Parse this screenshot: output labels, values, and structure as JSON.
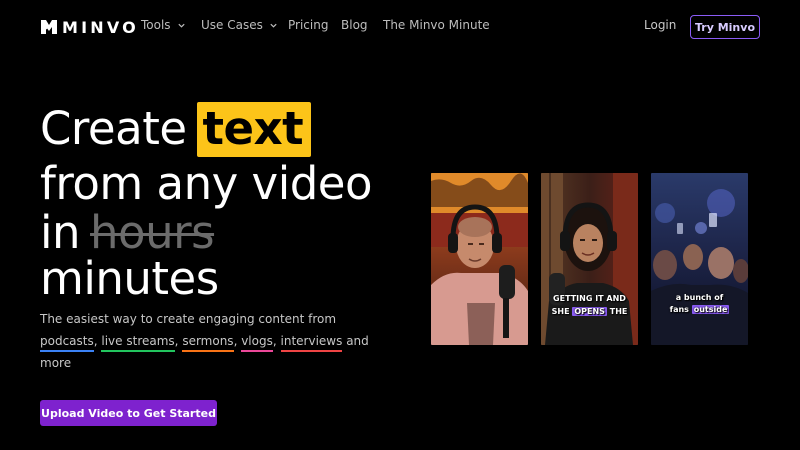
{
  "nav": {
    "logo_text": "MINVO",
    "items": [
      {
        "label": "Tools",
        "has_dropdown": true
      },
      {
        "label": "Use Cases",
        "has_dropdown": true
      },
      {
        "label": "Pricing",
        "has_dropdown": false
      },
      {
        "label": "Blog",
        "has_dropdown": false
      },
      {
        "label": "The Minvo Minute",
        "has_dropdown": false
      }
    ],
    "login_label": "Login",
    "try_label": "Try Minvo"
  },
  "hero": {
    "line1_plain": "Create",
    "line1_highlight": "text",
    "line2": "from any video",
    "line3_plain": "in",
    "line3_strike": "hours",
    "line4": "minutes",
    "subtitle_prefix": "The easiest way to create engaging content from",
    "subtitle_links": [
      "podcasts",
      "live streams",
      "sermons",
      "vlogs",
      "interviews"
    ],
    "subtitle_and": "and",
    "subtitle_suffix": "more",
    "cta_label": "Upload Video to Get Started"
  },
  "cards": [
    {
      "caption": ""
    },
    {
      "caption_line1_pre": "GETTING IT AND",
      "caption_line2_pre": "SHE",
      "caption_line2_highlight": "OPENS",
      "caption_line2_post": "THE"
    },
    {
      "caption_line1": "a bunch of",
      "caption_line2_pre": "fans",
      "caption_line2_highlight": "outside"
    }
  ],
  "colors": {
    "accent_yellow": "#fcc419",
    "cta_purple": "#7e22ce",
    "try_border": "#8b5cf6"
  }
}
